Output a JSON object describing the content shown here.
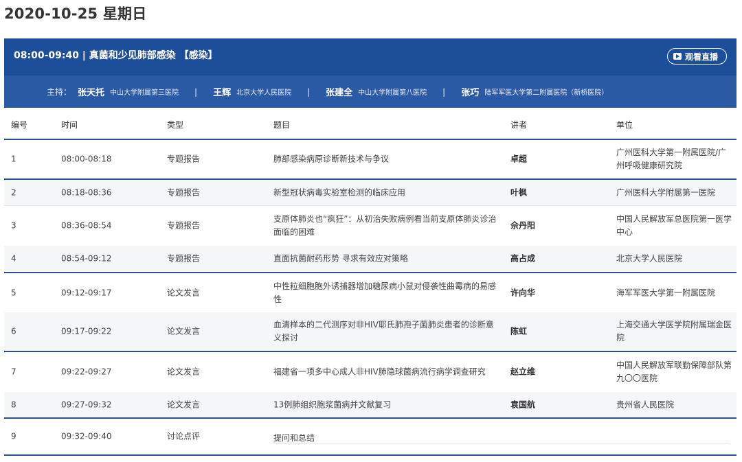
{
  "date": "2020-10-25 星期日",
  "session": {
    "title": "08:00-09:40 | 真菌和少见肺部感染 【感染】",
    "live_label": "观看直播"
  },
  "chairs": {
    "label": "主持：",
    "items": [
      {
        "name": "张天托",
        "org": "中山大学附属第三医院"
      },
      {
        "name": "王辉",
        "org": "北京大学人民医院"
      },
      {
        "name": "张建全",
        "org": "中山大学附属第八医院"
      },
      {
        "name": "张巧",
        "org": "陆军军医大学第二附属医院（新桥医院）"
      }
    ],
    "separator": "|"
  },
  "table": {
    "headers": [
      "编号",
      "时间",
      "类型",
      "题目",
      "讲者",
      "单位"
    ],
    "rows": [
      {
        "no": "1",
        "time": "08:00-08:18",
        "type": "专题报告",
        "topic": "肺部感染病原诊断新技术与争议",
        "speaker": "卓超",
        "org": "广州医科大学第一附属医院/广州呼吸健康研究院"
      },
      {
        "no": "2",
        "time": "08:18-08:36",
        "type": "专题报告",
        "topic": "新型冠状病毒实验室检测的临床应用",
        "speaker": "叶枫",
        "org": "广州医科大学附属第一医院"
      },
      {
        "no": "3",
        "time": "08:36-08:54",
        "type": "专题报告",
        "topic": "支原体肺炎也“疯狂”：从初治失败病例看当前支原体肺炎诊治面临的困难",
        "speaker": "佘丹阳",
        "org": "中国人民解放军总医院第一医学中心"
      },
      {
        "no": "4",
        "time": "08:54-09:12",
        "type": "专题报告",
        "topic": "直面抗菌耐药形势 寻求有效应对策略",
        "speaker": "高占成",
        "org": "北京大学人民医院"
      },
      {
        "no": "5",
        "time": "09:12-09:17",
        "type": "论文发言",
        "topic": "中性粒细胞胞外诱捕器增加糖尿病小鼠对侵袭性曲霉病的易感性",
        "speaker": "许向华",
        "org": "海军军医大学第一附属医院"
      },
      {
        "no": "6",
        "time": "09:17-09:22",
        "type": "论文发言",
        "topic": "血清样本的二代测序对非HIV耶氏肺孢子菌肺炎患者的诊断意义探讨",
        "speaker": "陈虹",
        "org": "上海交通大学医学院附属瑞金医院"
      },
      {
        "no": "7",
        "time": "09:22-09:27",
        "type": "论文发言",
        "topic": "福建省一项多中心成人非HIV肺隐球菌病流行病学调查研究",
        "speaker": "赵立维",
        "org": "中国人民解放军联勤保障部队第九〇〇医院"
      },
      {
        "no": "8",
        "time": "09:27-09:32",
        "type": "论文发言",
        "topic": "13例肺组织胞浆菌病并文献复习",
        "speaker": "袁国航",
        "org": "贵州省人民医院"
      },
      {
        "no": "9",
        "time": "09:32-09:40",
        "type": "讨论点评",
        "topic": "提问和总结",
        "speaker": "",
        "org": ""
      }
    ]
  }
}
